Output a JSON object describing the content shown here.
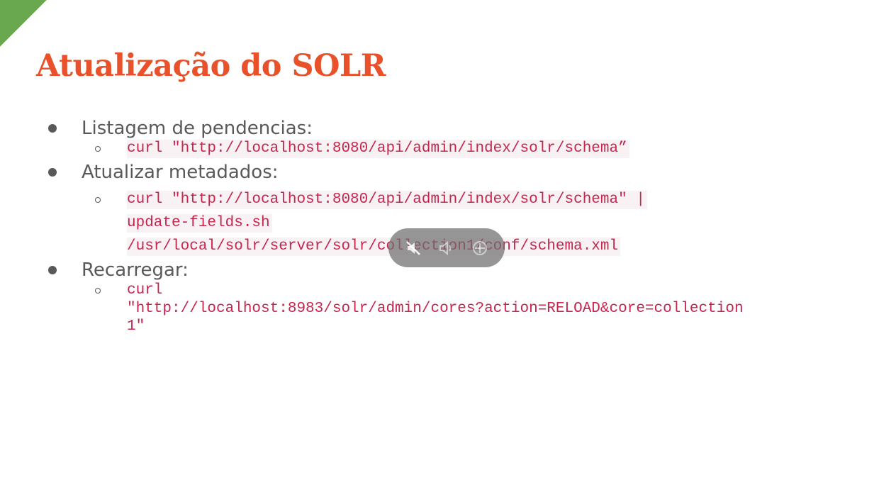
{
  "title": "Atualização do SOLR",
  "items": [
    {
      "label": "Listagem de pendencias:",
      "code_lines": [
        "curl \"http://localhost:8080/api/admin/index/solr/schema”"
      ]
    },
    {
      "label": "Atualizar metadados:",
      "code_lines": [
        "curl \"http://localhost:8080/api/admin/index/solr/schema\" |",
        "update-fields.sh",
        "/usr/local/solr/server/solr/collection1/conf/schema.xml"
      ]
    },
    {
      "label": "Recarregar:",
      "code_lines": [
        "curl",
        "\"http://localhost:8983/solr/admin/cores?action=RELOAD&core=collection",
        "1\""
      ]
    }
  ],
  "overlay_icons": [
    "muted-speaker-icon",
    "volume-icon",
    "target-icon"
  ],
  "colors": {
    "title": "#e8512a",
    "accent": "#6aa84f",
    "text": "#595959",
    "code": "#c7254e",
    "code_bg": "#f9f2f4"
  }
}
